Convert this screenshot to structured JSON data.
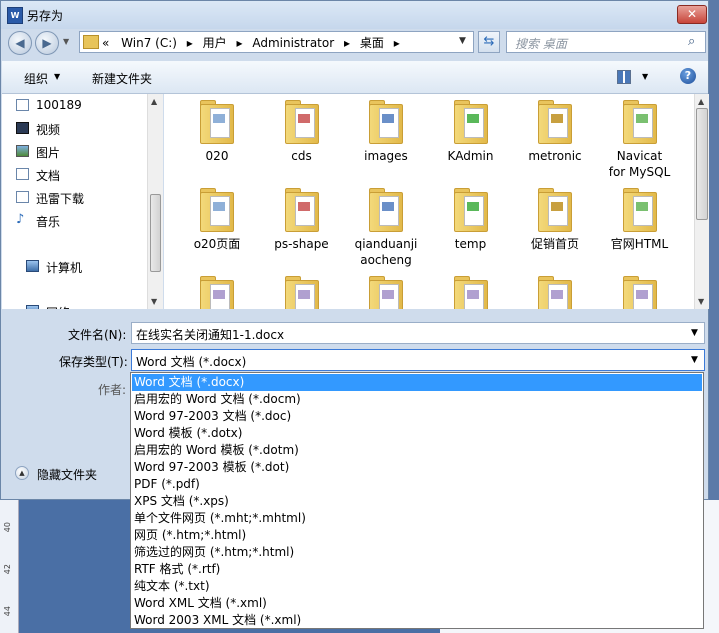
{
  "window": {
    "title": "另存为",
    "close_label": "✕",
    "icon_text": "W"
  },
  "nav": {
    "crumbs": [
      "«",
      "Win7 (C:)",
      "▸",
      "用户",
      "▸",
      "Administrator",
      "▸",
      "桌面",
      "▸"
    ],
    "search_placeholder": "搜索 桌面"
  },
  "toolbar": {
    "organize_label": "组织",
    "new_folder_label": "新建文件夹"
  },
  "sidebar": {
    "items": [
      {
        "label": "100189",
        "icon": "document-icon"
      },
      {
        "label": "视频",
        "icon": "video-icon"
      },
      {
        "label": "图片",
        "icon": "picture-icon"
      },
      {
        "label": "文档",
        "icon": "document-icon"
      },
      {
        "label": "迅雷下载",
        "icon": "download-icon"
      },
      {
        "label": "音乐",
        "icon": "music-icon"
      },
      {
        "label": "计算机",
        "icon": "computer-icon"
      },
      {
        "label": "网络",
        "icon": "network-icon"
      }
    ]
  },
  "files": [
    {
      "name": "020"
    },
    {
      "name": "cds"
    },
    {
      "name": "images"
    },
    {
      "name": "KAdmin"
    },
    {
      "name": "metronic"
    },
    {
      "name": "Navicat\nfor MySQL"
    },
    {
      "name": "o20页面"
    },
    {
      "name": "ps-shape"
    },
    {
      "name": "qianduanji\naocheng"
    },
    {
      "name": "temp"
    },
    {
      "name": "促销首页"
    },
    {
      "name": "官网HTML"
    }
  ],
  "form": {
    "filename_label": "文件名(N):",
    "filename_value": "在线实名关闭通知1-1.docx",
    "filetype_label": "保存类型(T):",
    "filetype_value": "Word 文档 (*.docx)",
    "author_label": "作者:",
    "hide_folders_label": "隐藏文件夹"
  },
  "filetype_options": [
    "Word 文档 (*.docx)",
    "启用宏的 Word 文档 (*.docm)",
    "Word 97-2003 文档 (*.doc)",
    "Word 模板 (*.dotx)",
    "启用宏的 Word 模板 (*.dotm)",
    "Word 97-2003 模板 (*.dot)",
    "PDF (*.pdf)",
    "XPS 文档 (*.xps)",
    "单个文件网页 (*.mht;*.mhtml)",
    "网页 (*.htm;*.html)",
    "筛选过的网页 (*.htm;*.html)",
    "RTF 格式 (*.rtf)",
    "纯文本 (*.txt)",
    "Word XML 文档 (*.xml)",
    "Word 2003 XML 文档 (*.xml)"
  ],
  "selected_option_index": 0,
  "ruler": {
    "labels": [
      "40",
      "42",
      "44"
    ]
  },
  "colors": {
    "selection": "#3399ff",
    "folder": "#e9c45c"
  }
}
